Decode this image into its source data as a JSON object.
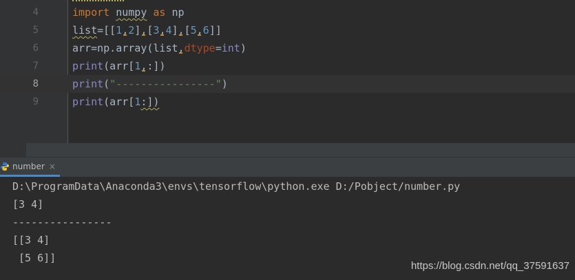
{
  "editor": {
    "lines": [
      {
        "num": "4"
      },
      {
        "num": "5"
      },
      {
        "num": "6"
      },
      {
        "num": "7"
      },
      {
        "num": "8"
      },
      {
        "num": "9"
      }
    ],
    "current_line": "8"
  },
  "code": {
    "l4": {
      "kw1": "import",
      "mod": "numpy",
      "kw2": "as",
      "alias": "np"
    },
    "l5": {
      "var": "list",
      "eq": "=",
      "o1": "[[",
      "a": "1",
      "c1": ",",
      "b": "2",
      "cl1": "],[",
      "c": "3",
      "c2": ",",
      "d": "4",
      "cl2": "],[",
      "e": "5",
      "c3": ",",
      "f": "6",
      "cl3": "]]"
    },
    "l6": {
      "pre": "arr=np.array(list",
      "comma": ",",
      "param": "dtype",
      "eq": "=",
      "type": "int",
      "close": ")"
    },
    "l7": {
      "fn": "print",
      "pre": "(arr[",
      "n": "1",
      "comma": ",",
      "post": ":])"
    },
    "l8": {
      "fn": "print",
      "open": "(",
      "str": "\"----------------\"",
      "close": ")"
    },
    "l9": {
      "fn": "print",
      "pre": "(arr[",
      "n": "1",
      "post": ":])"
    }
  },
  "run_panel": {
    "tab_label": "number",
    "close_glyph": "×",
    "icon": "python-icon"
  },
  "console": {
    "lines": [
      "D:\\ProgramData\\Anaconda3\\envs\\tensorflow\\python.exe D:/Pobject/number.py",
      "[3 4]",
      "----------------",
      "[[3 4]",
      " [5 6]]"
    ]
  },
  "watermark": "https://blog.csdn.net/qq_37591637",
  "colors": {
    "background": "#2b2b2b",
    "keyword": "#cc7832",
    "number": "#6897bb",
    "string": "#6a8759",
    "tab_underline": "#4a88c7"
  }
}
